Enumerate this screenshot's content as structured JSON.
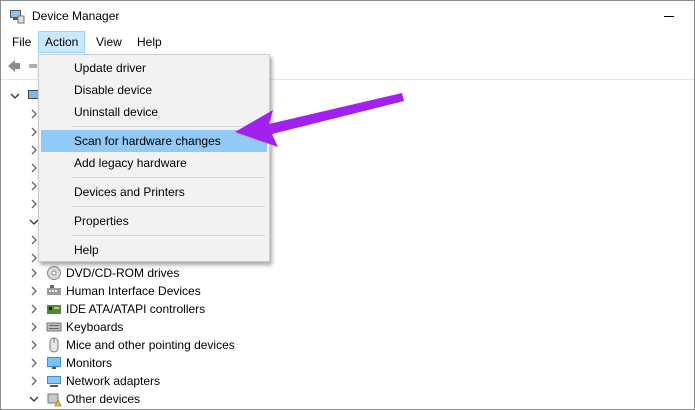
{
  "window": {
    "title": "Device Manager"
  },
  "menubar": {
    "items": [
      "File",
      "Action",
      "View",
      "Help"
    ],
    "active": "Action"
  },
  "action_menu": {
    "items": [
      {
        "label": "Update driver"
      },
      {
        "label": "Disable device"
      },
      {
        "label": "Uninstall device"
      },
      {
        "label": "Scan for hardware changes",
        "highlighted": true
      },
      {
        "label": "Add legacy hardware"
      },
      {
        "label": "Devices and Printers"
      },
      {
        "label": "Properties"
      },
      {
        "label": "Help"
      }
    ]
  },
  "tree": {
    "items": [
      {
        "label": "DVD/CD-ROM drives",
        "icon": "dvd-drive-icon"
      },
      {
        "label": "Human Interface Devices",
        "icon": "hid-icon"
      },
      {
        "label": "IDE ATA/ATAPI controllers",
        "icon": "ide-controller-icon"
      },
      {
        "label": "Keyboards",
        "icon": "keyboard-icon"
      },
      {
        "label": "Mice and other pointing devices",
        "icon": "mouse-icon"
      },
      {
        "label": "Monitors",
        "icon": "monitor-icon"
      },
      {
        "label": "Network adapters",
        "icon": "network-adapter-icon"
      },
      {
        "label": "Other devices",
        "icon": "warning-device-icon"
      }
    ]
  },
  "colors": {
    "menu_highlight": "#91c9f7",
    "menubar_active": "#cce8ff",
    "annotation_arrow": "#a321f0"
  }
}
